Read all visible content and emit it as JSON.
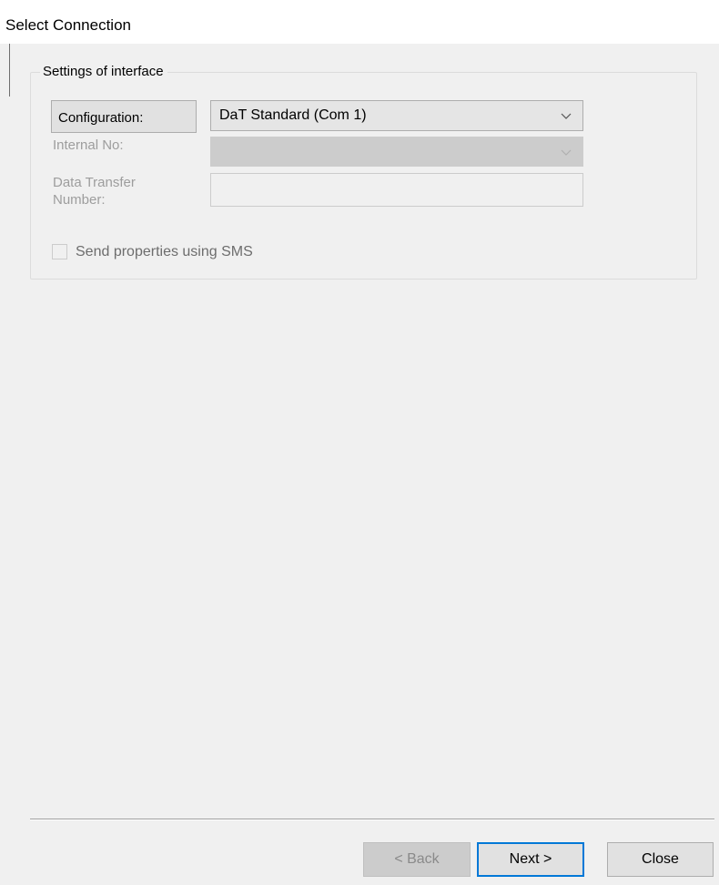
{
  "window": {
    "title": "Select Connection"
  },
  "group": {
    "legend": "Settings of interface",
    "configuration": {
      "label": "Configuration:",
      "selected_value": "DaT Standard (Com 1)"
    },
    "internal_no": {
      "label": "Internal No:",
      "selected_value": ""
    },
    "data_transfer_number": {
      "label": "Data Transfer Number:",
      "value": ""
    },
    "send_sms": {
      "label": "Send properties using SMS",
      "checked": false
    }
  },
  "footer": {
    "back_label": "< Back",
    "next_label": "Next >",
    "close_label": "Close"
  },
  "colors": {
    "focus_border": "#0078d7",
    "disabled_text": "#9d9d9d",
    "window_background": "#f0f0f0"
  },
  "icons": {
    "dropdown": "chevron-down-icon"
  }
}
